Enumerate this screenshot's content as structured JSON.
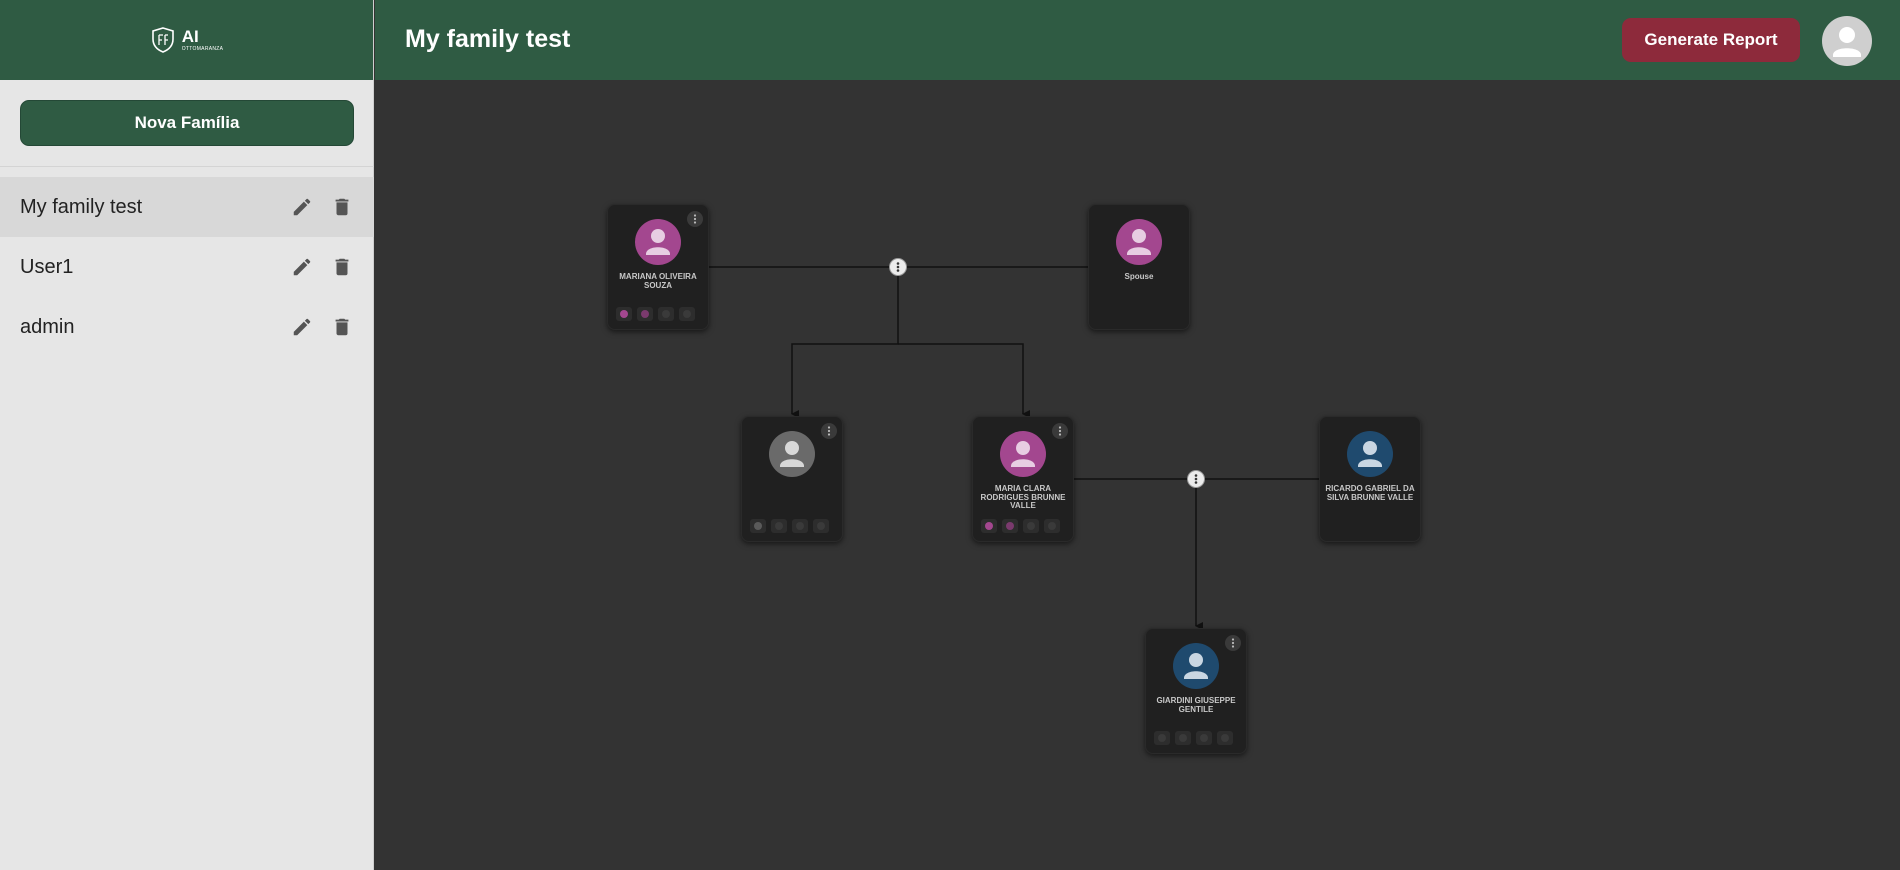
{
  "sidebar": {
    "logo": {
      "main": "AI",
      "sub": "OTTOMARANZA"
    },
    "new_family_label": "Nova Família",
    "families": [
      {
        "name": "My family test",
        "active": true
      },
      {
        "name": "User1",
        "active": false
      },
      {
        "name": "admin",
        "active": false
      }
    ]
  },
  "header": {
    "title": "My family test",
    "report_label": "Generate Report"
  },
  "tree": {
    "people": [
      {
        "id": "p1",
        "name": "MARIANA OLIVEIRA SOUZA",
        "gender": "female",
        "tools": true
      },
      {
        "id": "p2",
        "name": "Spouse",
        "gender": "female",
        "tools": false
      },
      {
        "id": "p3",
        "name": "",
        "gender": "unknown",
        "tools": true
      },
      {
        "id": "p4",
        "name": "MARIA CLARA RODRIGUES BRUNNE VALLE",
        "gender": "female",
        "tools": true
      },
      {
        "id": "p5",
        "name": "RICARDO GABRIEL DA SILVA BRUNNE VALLE",
        "gender": "male",
        "tools": false
      },
      {
        "id": "p6",
        "name": "GIARDINI GIUSEPPE GENTILE",
        "gender": "male",
        "tools": true
      }
    ]
  },
  "colors": {
    "header_green": "#2f5b43",
    "report_red": "#8d2a3b",
    "female": "#a3478f",
    "male": "#1f4a6e",
    "unknown": "#6a6a6a"
  },
  "icons": {
    "edit": "edit-icon",
    "delete": "trash-icon",
    "menu": "more-vertical-icon",
    "person": "person-icon",
    "avatar": "user-avatar-icon"
  }
}
